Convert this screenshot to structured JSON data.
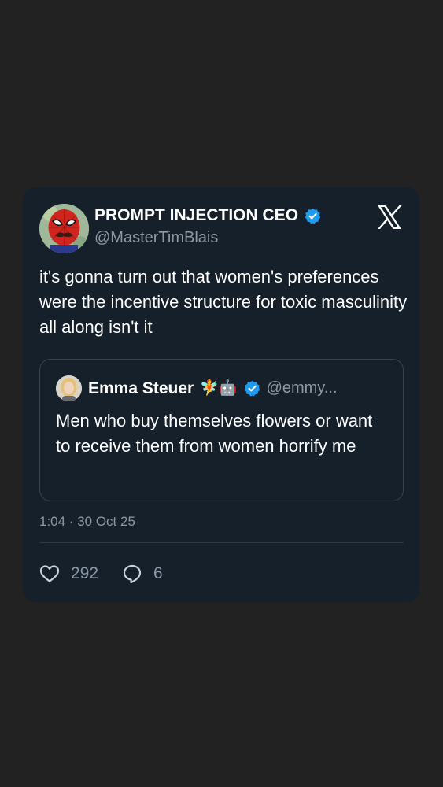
{
  "tweet": {
    "author": {
      "name": "PROMPT INJECTION CEO",
      "handle": "@MasterTimBlais",
      "avatar_icon": "spider-man-avatar",
      "verified": true
    },
    "platform_icon": "x-logo-icon",
    "text": "it's gonna turn out that women's preferences were the incentive structure for toxic masculinity all along isn't it",
    "quoted_tweet": {
      "author_name": "Emma Steuer",
      "name_emojis": "🧚🤖",
      "handle": "@emmy...",
      "verified": true,
      "text": "Men who buy themselves flowers or want to receive them from women horrify me"
    },
    "timestamp": "1:04 · 30 Oct 25",
    "likes": "292",
    "replies": "6"
  },
  "colors": {
    "background": "#222222",
    "card": "#15202b",
    "text_primary": "#ffffff",
    "text_secondary": "#8b98a5",
    "verified_blue": "#1d9bf0",
    "border": "#38444d"
  }
}
